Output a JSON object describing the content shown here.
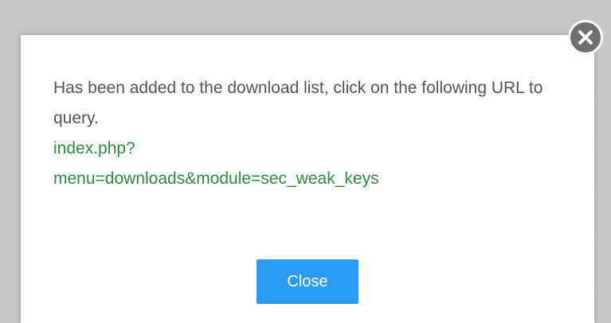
{
  "dialog": {
    "message_line1": "Has been added to the download list, click on the following URL to query.",
    "link_line1": "index.php?",
    "link_line2": "menu=downloads&module=sec_weak_keys",
    "close_button_label": "Close"
  },
  "colors": {
    "link": "#2e8b3e",
    "button": "#2b9af3",
    "close_icon_bg": "#6f6f6f",
    "text": "#555555"
  }
}
